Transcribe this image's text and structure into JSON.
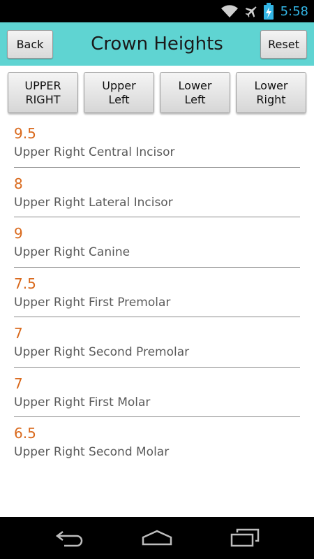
{
  "status_bar": {
    "time": "5:58",
    "icons": [
      "wifi-icon",
      "airplane-icon",
      "battery-charging-icon"
    ]
  },
  "action_bar": {
    "back_label": "Back",
    "title": "Crown Heights",
    "reset_label": "Reset",
    "color": "#5fd4d2"
  },
  "tabs": [
    {
      "label": "UPPER\nRIGHT"
    },
    {
      "label": "Upper\nLeft"
    },
    {
      "label": "Lower\nLeft"
    },
    {
      "label": "Lower\nRight"
    }
  ],
  "items": [
    {
      "value": "9.5",
      "label": "Upper Right Central Incisor"
    },
    {
      "value": "8",
      "label": "Upper Right Lateral Incisor"
    },
    {
      "value": "9",
      "label": "Upper Right Canine"
    },
    {
      "value": "7.5",
      "label": "Upper Right First Premolar"
    },
    {
      "value": "7",
      "label": "Upper Right Second Premolar"
    },
    {
      "value": "7",
      "label": "Upper Right First Molar"
    },
    {
      "value": "6.5",
      "label": "Upper Right Second Molar"
    }
  ],
  "colors": {
    "value_text": "#d9691c",
    "label_text": "#5a5a5a",
    "status_accent": "#33b5e5"
  },
  "nav_bar": {
    "icons": [
      "back-nav-icon",
      "home-nav-icon",
      "recent-apps-icon"
    ]
  }
}
